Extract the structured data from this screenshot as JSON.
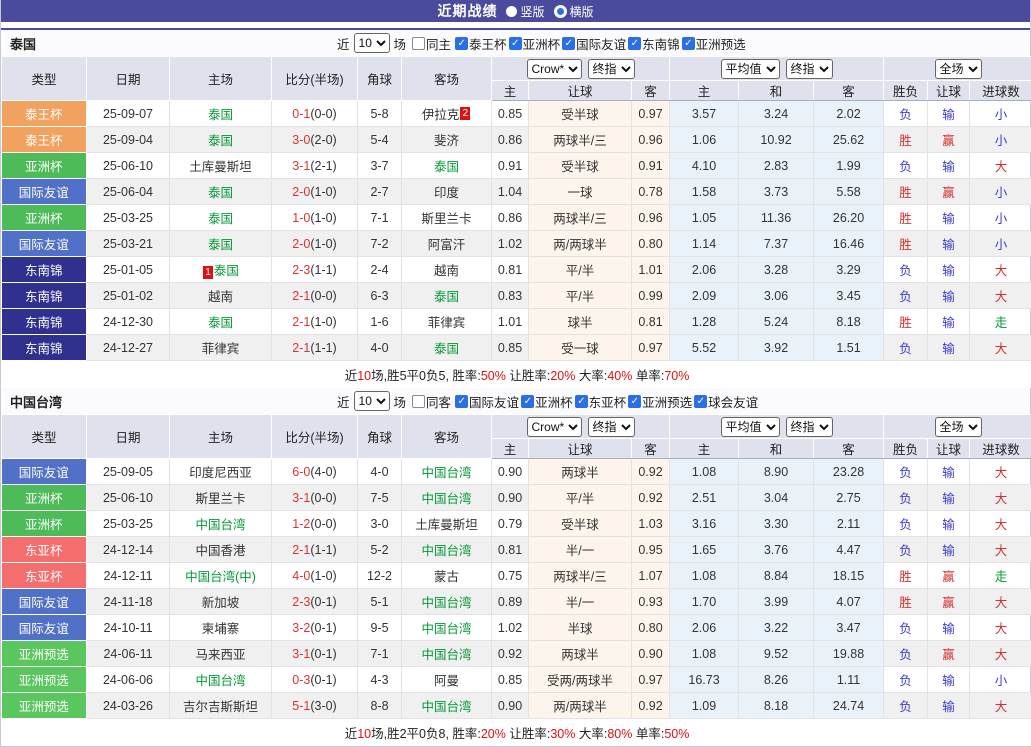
{
  "page": {
    "title": "近期战绩",
    "layout_options": [
      {
        "label": "竖版",
        "checked": false
      },
      {
        "label": "横版",
        "checked": true
      }
    ]
  },
  "table_header": {
    "type": "类型",
    "date": "日期",
    "home": "主场",
    "score": "比分(半场)",
    "corner": "角球",
    "away": "客场",
    "selects": {
      "crow": "Crow*",
      "final": "终指",
      "avg": "平均值",
      "full": "全场"
    },
    "sub": [
      "主",
      "让球",
      "客",
      "主",
      "和",
      "客",
      "胜负",
      "让球",
      "进球数"
    ]
  },
  "comp_colors": {
    "泰王杯": "#f2a25f",
    "亚洲杯": "#4dbb57",
    "国际友谊": "#5170c8",
    "东南锦": "#30308e",
    "东亚杯": "#f56e6e",
    "亚洲预选": "#5ac75e"
  },
  "accent": {
    "bar": "#4b4b9e",
    "check_blue": "#2a6fe8"
  },
  "sections": [
    {
      "team": "泰国",
      "filter": {
        "near_label": "近",
        "count": "10",
        "games_label": "场",
        "same_label": "同主",
        "same_checked": false,
        "comps": [
          "泰王杯",
          "亚洲杯",
          "国际友谊",
          "东南锦",
          "亚洲预选"
        ]
      },
      "rows": [
        {
          "comp": "泰王杯",
          "date": "25-09-07",
          "home": {
            "name": "泰国",
            "focal": true
          },
          "away": {
            "name": "伊拉克",
            "mark": "2"
          },
          "ft": "0-1",
          "ht": "(0-0)",
          "corner": "5-8",
          "crow": [
            "0.85",
            "受半球",
            "0.97"
          ],
          "avg": [
            "3.57",
            "3.24",
            "2.02"
          ],
          "res": [
            {
              "t": "负",
              "c": "blue"
            },
            {
              "t": "输",
              "c": "blue"
            },
            {
              "t": "小",
              "c": "blue"
            }
          ]
        },
        {
          "comp": "泰王杯",
          "date": "25-09-04",
          "home": {
            "name": "泰国",
            "focal": true
          },
          "away": {
            "name": "斐济"
          },
          "ft": "3-0",
          "ht": "(2-0)",
          "corner": "5-4",
          "crow": [
            "0.86",
            "两球半/三",
            "0.96"
          ],
          "avg": [
            "1.06",
            "10.92",
            "25.62"
          ],
          "res": [
            {
              "t": "胜",
              "c": "red"
            },
            {
              "t": "赢",
              "c": "red"
            },
            {
              "t": "小",
              "c": "blue"
            }
          ]
        },
        {
          "comp": "亚洲杯",
          "date": "25-06-10",
          "home": {
            "name": "土库曼斯坦"
          },
          "away": {
            "name": "泰国",
            "focal": true
          },
          "ft": "3-1",
          "ht": "(2-1)",
          "corner": "3-7",
          "crow": [
            "0.91",
            "受半球",
            "0.91"
          ],
          "avg": [
            "4.10",
            "2.83",
            "1.99"
          ],
          "res": [
            {
              "t": "负",
              "c": "blue"
            },
            {
              "t": "输",
              "c": "blue"
            },
            {
              "t": "大",
              "c": "red"
            }
          ]
        },
        {
          "comp": "国际友谊",
          "date": "25-06-04",
          "home": {
            "name": "泰国",
            "focal": true
          },
          "away": {
            "name": "印度"
          },
          "ft": "2-0",
          "ht": "(1-0)",
          "corner": "2-7",
          "crow": [
            "1.04",
            "一球",
            "0.78"
          ],
          "avg": [
            "1.58",
            "3.73",
            "5.58"
          ],
          "res": [
            {
              "t": "胜",
              "c": "red"
            },
            {
              "t": "赢",
              "c": "red"
            },
            {
              "t": "小",
              "c": "blue"
            }
          ]
        },
        {
          "comp": "亚洲杯",
          "date": "25-03-25",
          "home": {
            "name": "泰国",
            "focal": true
          },
          "away": {
            "name": "斯里兰卡"
          },
          "ft": "1-0",
          "ht": "(1-0)",
          "corner": "7-1",
          "crow": [
            "0.86",
            "两球半/三",
            "0.96"
          ],
          "avg": [
            "1.05",
            "11.36",
            "26.20"
          ],
          "res": [
            {
              "t": "胜",
              "c": "red"
            },
            {
              "t": "输",
              "c": "blue"
            },
            {
              "t": "小",
              "c": "blue"
            }
          ]
        },
        {
          "comp": "国际友谊",
          "date": "25-03-21",
          "home": {
            "name": "泰国",
            "focal": true
          },
          "away": {
            "name": "阿富汗"
          },
          "ft": "2-0",
          "ht": "(1-0)",
          "corner": "7-2",
          "crow": [
            "1.02",
            "两/两球半",
            "0.80"
          ],
          "avg": [
            "1.14",
            "7.37",
            "16.46"
          ],
          "res": [
            {
              "t": "胜",
              "c": "red"
            },
            {
              "t": "输",
              "c": "blue"
            },
            {
              "t": "小",
              "c": "blue"
            }
          ]
        },
        {
          "comp": "东南锦",
          "date": "25-01-05",
          "home": {
            "name": "泰国",
            "focal": true,
            "mark": "1"
          },
          "away": {
            "name": "越南"
          },
          "ft": "2-3",
          "ht": "(1-1)",
          "corner": "2-4",
          "crow": [
            "0.81",
            "平/半",
            "1.01"
          ],
          "avg": [
            "2.06",
            "3.28",
            "3.29"
          ],
          "res": [
            {
              "t": "负",
              "c": "blue"
            },
            {
              "t": "输",
              "c": "blue"
            },
            {
              "t": "大",
              "c": "red"
            }
          ]
        },
        {
          "comp": "东南锦",
          "date": "25-01-02",
          "home": {
            "name": "越南"
          },
          "away": {
            "name": "泰国",
            "focal": true
          },
          "ft": "2-1",
          "ht": "(0-0)",
          "corner": "6-3",
          "crow": [
            "0.83",
            "平/半",
            "0.99"
          ],
          "avg": [
            "2.09",
            "3.06",
            "3.45"
          ],
          "res": [
            {
              "t": "负",
              "c": "blue"
            },
            {
              "t": "输",
              "c": "blue"
            },
            {
              "t": "大",
              "c": "red"
            }
          ]
        },
        {
          "comp": "东南锦",
          "date": "24-12-30",
          "home": {
            "name": "泰国",
            "focal": true
          },
          "away": {
            "name": "菲律宾"
          },
          "ft": "2-1",
          "ht": "(1-0)",
          "corner": "1-6",
          "crow": [
            "1.01",
            "球半",
            "0.81"
          ],
          "avg": [
            "1.28",
            "5.24",
            "8.18"
          ],
          "res": [
            {
              "t": "胜",
              "c": "red"
            },
            {
              "t": "输",
              "c": "blue"
            },
            {
              "t": "走",
              "c": "green"
            }
          ]
        },
        {
          "comp": "东南锦",
          "date": "24-12-27",
          "home": {
            "name": "菲律宾"
          },
          "away": {
            "name": "泰国",
            "focal": true
          },
          "ft": "2-1",
          "ht": "(1-1)",
          "corner": "4-0",
          "crow": [
            "0.85",
            "受一球",
            "0.97"
          ],
          "avg": [
            "5.52",
            "3.92",
            "1.51"
          ],
          "res": [
            {
              "t": "负",
              "c": "blue"
            },
            {
              "t": "输",
              "c": "blue"
            },
            {
              "t": "大",
              "c": "red"
            }
          ]
        }
      ],
      "summary": [
        {
          "text": "近",
          "red": false
        },
        {
          "text": "10",
          "red": true
        },
        {
          "text": "场,胜5平0负5, 胜率:",
          "red": false
        },
        {
          "text": "50%",
          "red": true
        },
        {
          "text": " 让胜率:",
          "red": false
        },
        {
          "text": "20%",
          "red": true
        },
        {
          "text": " 大率:",
          "red": false
        },
        {
          "text": "40%",
          "red": true
        },
        {
          "text": " 单率:",
          "red": false
        },
        {
          "text": "70%",
          "red": true
        }
      ]
    },
    {
      "team": "中国台湾",
      "filter": {
        "near_label": "近",
        "count": "10",
        "games_label": "场",
        "same_label": "同客",
        "same_checked": false,
        "comps": [
          "国际友谊",
          "亚洲杯",
          "东亚杯",
          "亚洲预选",
          "球会友谊"
        ]
      },
      "rows": [
        {
          "comp": "国际友谊",
          "date": "25-09-05",
          "home": {
            "name": "印度尼西亚"
          },
          "away": {
            "name": "中国台湾",
            "focal": true
          },
          "ft": "6-0",
          "ht": "(4-0)",
          "corner": "4-0",
          "crow": [
            "0.90",
            "两球半",
            "0.92"
          ],
          "avg": [
            "1.08",
            "8.90",
            "23.28"
          ],
          "res": [
            {
              "t": "负",
              "c": "blue"
            },
            {
              "t": "输",
              "c": "blue"
            },
            {
              "t": "大",
              "c": "red"
            }
          ]
        },
        {
          "comp": "亚洲杯",
          "date": "25-06-10",
          "home": {
            "name": "斯里兰卡"
          },
          "away": {
            "name": "中国台湾",
            "focal": true
          },
          "ft": "3-1",
          "ht": "(0-0)",
          "corner": "7-5",
          "crow": [
            "0.90",
            "平/半",
            "0.92"
          ],
          "avg": [
            "2.51",
            "3.04",
            "2.75"
          ],
          "res": [
            {
              "t": "负",
              "c": "blue"
            },
            {
              "t": "输",
              "c": "blue"
            },
            {
              "t": "大",
              "c": "red"
            }
          ]
        },
        {
          "comp": "亚洲杯",
          "date": "25-03-25",
          "home": {
            "name": "中国台湾",
            "focal": true
          },
          "away": {
            "name": "土库曼斯坦"
          },
          "ft": "1-2",
          "ht": "(0-0)",
          "corner": "3-0",
          "crow": [
            "0.79",
            "受半球",
            "1.03"
          ],
          "avg": [
            "3.16",
            "3.30",
            "2.11"
          ],
          "res": [
            {
              "t": "负",
              "c": "blue"
            },
            {
              "t": "输",
              "c": "blue"
            },
            {
              "t": "大",
              "c": "red"
            }
          ]
        },
        {
          "comp": "东亚杯",
          "date": "24-12-14",
          "home": {
            "name": "中国香港"
          },
          "away": {
            "name": "中国台湾",
            "focal": true
          },
          "ft": "2-1",
          "ht": "(1-1)",
          "corner": "5-2",
          "crow": [
            "0.81",
            "半/一",
            "0.95"
          ],
          "avg": [
            "1.65",
            "3.76",
            "4.47"
          ],
          "res": [
            {
              "t": "负",
              "c": "blue"
            },
            {
              "t": "输",
              "c": "blue"
            },
            {
              "t": "大",
              "c": "red"
            }
          ]
        },
        {
          "comp": "东亚杯",
          "date": "24-12-11",
          "home": {
            "name": "中国台湾(中)",
            "focal": true
          },
          "away": {
            "name": "蒙古"
          },
          "ft": "4-0",
          "ht": "(1-0)",
          "corner": "12-2",
          "crow": [
            "0.75",
            "两球半/三",
            "1.07"
          ],
          "avg": [
            "1.08",
            "8.84",
            "18.15"
          ],
          "res": [
            {
              "t": "胜",
              "c": "red"
            },
            {
              "t": "赢",
              "c": "red"
            },
            {
              "t": "走",
              "c": "green"
            }
          ]
        },
        {
          "comp": "国际友谊",
          "date": "24-11-18",
          "home": {
            "name": "新加坡"
          },
          "away": {
            "name": "中国台湾",
            "focal": true
          },
          "ft": "2-3",
          "ht": "(0-1)",
          "corner": "5-1",
          "crow": [
            "0.89",
            "半/一",
            "0.93"
          ],
          "avg": [
            "1.70",
            "3.99",
            "4.07"
          ],
          "res": [
            {
              "t": "胜",
              "c": "red"
            },
            {
              "t": "赢",
              "c": "red"
            },
            {
              "t": "大",
              "c": "red"
            }
          ]
        },
        {
          "comp": "国际友谊",
          "date": "24-10-11",
          "home": {
            "name": "柬埔寨"
          },
          "away": {
            "name": "中国台湾",
            "focal": true
          },
          "ft": "3-2",
          "ht": "(0-1)",
          "corner": "9-5",
          "crow": [
            "1.02",
            "半球",
            "0.80"
          ],
          "avg": [
            "2.06",
            "3.22",
            "3.47"
          ],
          "res": [
            {
              "t": "负",
              "c": "blue"
            },
            {
              "t": "输",
              "c": "blue"
            },
            {
              "t": "大",
              "c": "red"
            }
          ]
        },
        {
          "comp": "亚洲预选",
          "date": "24-06-11",
          "home": {
            "name": "马来西亚"
          },
          "away": {
            "name": "中国台湾",
            "focal": true
          },
          "ft": "3-1",
          "ht": "(0-1)",
          "corner": "7-1",
          "crow": [
            "0.92",
            "两球半",
            "0.90"
          ],
          "avg": [
            "1.08",
            "9.52",
            "19.88"
          ],
          "res": [
            {
              "t": "负",
              "c": "blue"
            },
            {
              "t": "赢",
              "c": "red"
            },
            {
              "t": "大",
              "c": "red"
            }
          ]
        },
        {
          "comp": "亚洲预选",
          "date": "24-06-06",
          "home": {
            "name": "中国台湾",
            "focal": true
          },
          "away": {
            "name": "阿曼"
          },
          "ft": "0-3",
          "ht": "(0-1)",
          "corner": "4-3",
          "crow": [
            "0.85",
            "受两/两球半",
            "0.97"
          ],
          "avg": [
            "16.73",
            "8.26",
            "1.11"
          ],
          "res": [
            {
              "t": "负",
              "c": "blue"
            },
            {
              "t": "输",
              "c": "blue"
            },
            {
              "t": "小",
              "c": "blue"
            }
          ]
        },
        {
          "comp": "亚洲预选",
          "date": "24-03-26",
          "home": {
            "name": "吉尔吉斯斯坦"
          },
          "away": {
            "name": "中国台湾",
            "focal": true
          },
          "ft": "5-1",
          "ht": "(3-0)",
          "corner": "8-8",
          "crow": [
            "0.90",
            "两/两球半",
            "0.92"
          ],
          "avg": [
            "1.09",
            "8.18",
            "24.74"
          ],
          "res": [
            {
              "t": "负",
              "c": "blue"
            },
            {
              "t": "输",
              "c": "blue"
            },
            {
              "t": "大",
              "c": "red"
            }
          ]
        }
      ],
      "summary": [
        {
          "text": "近",
          "red": false
        },
        {
          "text": "10",
          "red": true
        },
        {
          "text": "场,胜2平0负8, 胜率:",
          "red": false
        },
        {
          "text": "20%",
          "red": true
        },
        {
          "text": " 让胜率:",
          "red": false
        },
        {
          "text": "30%",
          "red": true
        },
        {
          "text": " 大率:",
          "red": false
        },
        {
          "text": "80%",
          "red": true
        },
        {
          "text": " 单率:",
          "red": false
        },
        {
          "text": "50%",
          "red": true
        }
      ]
    }
  ]
}
